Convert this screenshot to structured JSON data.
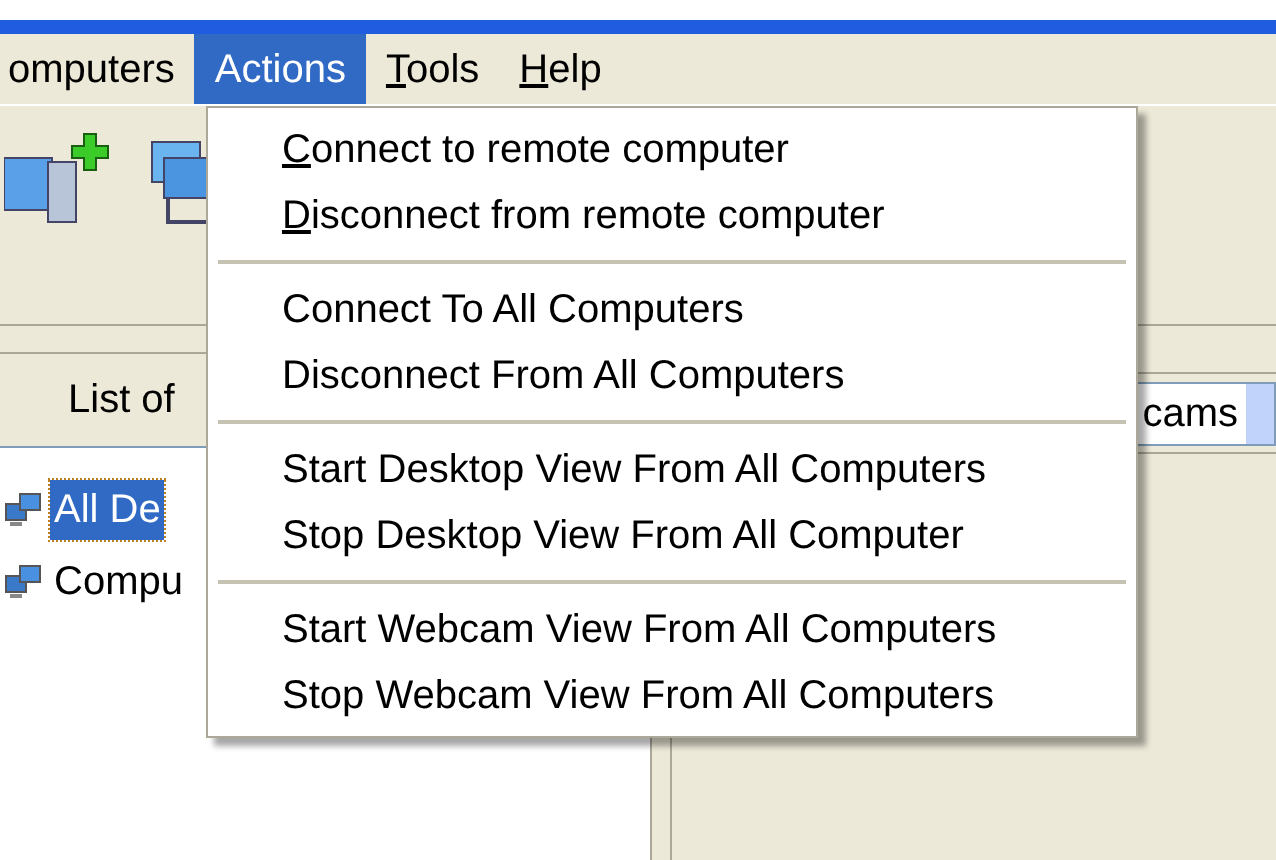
{
  "menu_bar": [
    {
      "label": "omputers",
      "selected": false,
      "mnemonic": false
    },
    {
      "label": "Actions",
      "selected": true,
      "mnemonic": false
    },
    {
      "label": "Tools",
      "selected": false,
      "mnemonic": true
    },
    {
      "label": "Help",
      "selected": false,
      "mnemonic": true
    }
  ],
  "computer_list": {
    "header": "List of",
    "items": [
      {
        "label": "All De",
        "selected": true
      },
      {
        "label": "Compu",
        "selected": false
      }
    ]
  },
  "view_dropdown": {
    "value": "cams"
  },
  "actions_menu": [
    [
      {
        "label": "Connect to remote computer",
        "mnemonic": true
      },
      {
        "label": "Disconnect from remote computer",
        "mnemonic": true
      }
    ],
    [
      {
        "label": "Connect To All Computers",
        "mnemonic": false
      },
      {
        "label": "Disconnect From All Computers",
        "mnemonic": false
      }
    ],
    [
      {
        "label": "Start Desktop View From All Computers",
        "mnemonic": false
      },
      {
        "label": "Stop Desktop View From All Computer",
        "mnemonic": false
      }
    ],
    [
      {
        "label": "Start Webcam View From All Computers",
        "mnemonic": false
      },
      {
        "label": "Stop Webcam View From All Computers",
        "mnemonic": false
      }
    ]
  ]
}
